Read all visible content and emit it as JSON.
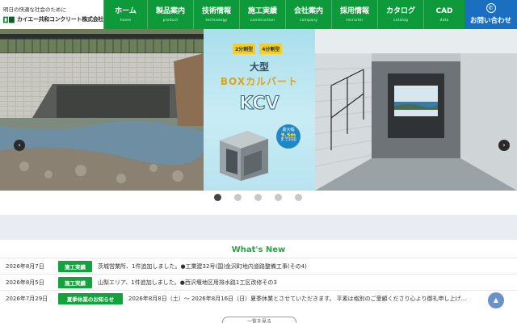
{
  "logo": {
    "tagline": "明日の快適な社会のために",
    "company": "カイエー共和コンクリート株式会社"
  },
  "nav": {
    "items": [
      {
        "jp": "ホーム",
        "en": "home"
      },
      {
        "jp": "製品案内",
        "en": "product"
      },
      {
        "jp": "技術情報",
        "en": "technology"
      },
      {
        "jp": "施工実績",
        "en": "construction"
      },
      {
        "jp": "会社案内",
        "en": "company"
      },
      {
        "jp": "採用情報",
        "en": "recruiter"
      },
      {
        "jp": "カタログ",
        "en": "catalog"
      },
      {
        "jp": "CAD",
        "en": "data"
      }
    ],
    "contact": "お問い合わせ"
  },
  "hero": {
    "badge1": "2分割型",
    "badge2": "4分割型",
    "line1": "大型",
    "line2": "BOXカルバート",
    "title": "KCV",
    "round_top": "最大幅",
    "round_mid": "9.5m",
    "round_bottom": "まで対応",
    "prev": "‹",
    "next": "›"
  },
  "slider": {
    "count": 5,
    "active_index": 0
  },
  "news": {
    "title": "What's New",
    "items": [
      {
        "date": "2026年8月7日",
        "tag": "施工実績",
        "text": "茨城営業所、1件追加しました。●工業建32号(国)金沢町地内道路整備工事(その4)"
      },
      {
        "date": "2026年8月5日",
        "tag": "施工実績",
        "text": "山梨エリア、1件追加しました。●西沢堰地区用排水路1工区改修その3"
      },
      {
        "date": "2026年7月29日",
        "tag": "夏季休業のお知らせ",
        "text": "2026年8月8日（土）～ 2026年8月16日（日）夏季休業とさせていただきます。 平素は格別のご愛顧くださり心より御礼申し上げ…"
      }
    ],
    "more": "一覧を見る"
  },
  "colors": {
    "nav_green": "#0e9a3a",
    "contact_blue": "#1a6fc0",
    "tag_green": "#14a23f",
    "heading_green": "#1faa3c"
  }
}
